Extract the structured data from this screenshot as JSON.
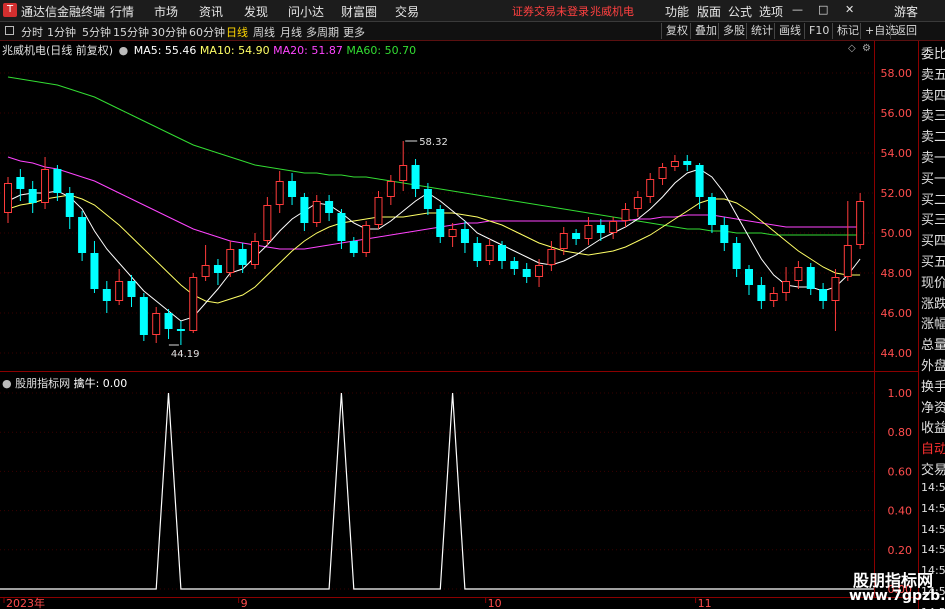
{
  "app": {
    "title": "通达信金融终端"
  },
  "menu": [
    "行情",
    "市场",
    "资讯",
    "发现",
    "问小达",
    "财富圈",
    "交易"
  ],
  "alert": {
    "text1": "证券交易未登录",
    "text2": "兆威机电"
  },
  "menu_right": [
    "功能",
    "版面",
    "公式",
    "选项"
  ],
  "guest": "游客",
  "window_controls": {
    "min": "—",
    "restore": "□",
    "close": "✕"
  },
  "periods": [
    "分时",
    "1分钟",
    "5分钟",
    "15分钟",
    "30分钟",
    "60分钟",
    "日线",
    "周线",
    "月线",
    "多周期",
    "更多"
  ],
  "active_period": "日线",
  "toolbar_right": [
    "复权",
    "叠加",
    "多股",
    "统计",
    "画线",
    "F10",
    "标记",
    "+自选",
    "返回"
  ],
  "main": {
    "stock_name": "兆威机电(日线 前复权)",
    "ma": [
      {
        "label": "MA5: 55.46",
        "color": "#ffffff"
      },
      {
        "label": "MA10: 54.90",
        "color": "#ffff66"
      },
      {
        "label": "MA20: 51.87",
        "color": "#ff44ff"
      },
      {
        "label": "MA60: 50.70",
        "color": "#33dd33"
      }
    ],
    "high_label": "58.32",
    "low_label": "44.19"
  },
  "sub": {
    "indicator_name": "股朋指标网",
    "value_label": "擒牛: 0.00"
  },
  "chart_data": [
    {
      "type": "candlestick",
      "y_ticks": [
        "58.00",
        "56.00",
        "54.00",
        "52.00",
        "50.00",
        "48.00",
        "46.00",
        "44.00"
      ],
      "ylim": [
        43.2,
        59.6
      ],
      "x_labels": [
        {
          "i": 0,
          "label": "2023年"
        },
        {
          "i": 19,
          "label": "9"
        },
        {
          "i": 39,
          "label": "10"
        },
        {
          "i": 56,
          "label": "11"
        }
      ],
      "candles": [
        [
          51.0,
          52.5,
          50.5,
          52.8
        ],
        [
          52.8,
          52.2,
          51.6,
          53.2
        ],
        [
          52.2,
          51.5,
          51.0,
          52.6
        ],
        [
          51.5,
          53.2,
          51.2,
          53.8
        ],
        [
          53.2,
          52.0,
          51.6,
          53.4
        ],
        [
          52.0,
          50.8,
          50.2,
          52.3
        ],
        [
          50.8,
          49.0,
          48.6,
          51.1
        ],
        [
          49.0,
          47.2,
          47.0,
          49.6
        ],
        [
          47.2,
          46.6,
          46.0,
          47.6
        ],
        [
          46.6,
          47.6,
          46.4,
          48.2
        ],
        [
          47.6,
          46.8,
          46.3,
          47.9
        ],
        [
          46.8,
          44.9,
          44.6,
          47.0
        ],
        [
          44.9,
          46.0,
          44.5,
          46.3
        ],
        [
          46.0,
          45.2,
          44.7,
          46.2
        ],
        [
          45.2,
          45.1,
          44.4,
          45.6
        ],
        [
          45.1,
          47.8,
          45.0,
          48.0
        ],
        [
          47.8,
          48.4,
          47.6,
          49.4
        ],
        [
          48.4,
          48.0,
          47.4,
          48.7
        ],
        [
          48.0,
          49.2,
          47.8,
          49.6
        ],
        [
          49.2,
          48.4,
          48.0,
          49.5
        ],
        [
          48.4,
          49.6,
          48.2,
          50.0
        ],
        [
          49.6,
          51.4,
          49.4,
          51.8
        ],
        [
          51.4,
          52.6,
          51.0,
          53.1
        ],
        [
          52.6,
          51.8,
          51.4,
          53.0
        ],
        [
          51.8,
          50.5,
          50.1,
          52.0
        ],
        [
          50.5,
          51.6,
          50.3,
          51.9
        ],
        [
          51.6,
          51.0,
          50.6,
          51.9
        ],
        [
          51.0,
          49.6,
          49.2,
          51.2
        ],
        [
          49.6,
          49.0,
          48.8,
          49.8
        ],
        [
          49.0,
          50.4,
          48.8,
          50.6
        ],
        [
          50.4,
          51.8,
          50.2,
          52.1
        ],
        [
          51.8,
          52.6,
          51.4,
          52.9
        ],
        [
          52.6,
          53.4,
          52.1,
          54.6
        ],
        [
          53.4,
          52.2,
          51.8,
          53.7
        ],
        [
          52.2,
          51.2,
          50.9,
          52.5
        ],
        [
          51.2,
          49.8,
          49.5,
          51.4
        ],
        [
          49.8,
          50.2,
          49.3,
          50.5
        ],
        [
          50.2,
          49.5,
          49.0,
          50.6
        ],
        [
          49.5,
          48.6,
          48.3,
          49.8
        ],
        [
          48.6,
          49.4,
          48.4,
          49.7
        ],
        [
          49.4,
          48.6,
          48.2,
          49.6
        ],
        [
          48.6,
          48.2,
          47.9,
          48.8
        ],
        [
          48.2,
          47.8,
          47.5,
          48.5
        ],
        [
          47.8,
          48.4,
          47.3,
          48.7
        ],
        [
          48.4,
          49.2,
          48.1,
          49.6
        ],
        [
          49.2,
          50.0,
          48.9,
          50.3
        ],
        [
          50.0,
          49.7,
          49.4,
          50.2
        ],
        [
          49.7,
          50.4,
          49.4,
          50.8
        ],
        [
          50.4,
          50.0,
          49.6,
          50.7
        ],
        [
          50.0,
          50.6,
          49.7,
          50.8
        ],
        [
          50.6,
          51.2,
          50.3,
          51.5
        ],
        [
          51.2,
          51.8,
          50.8,
          52.1
        ],
        [
          51.8,
          52.7,
          51.5,
          53.0
        ],
        [
          52.7,
          53.3,
          52.4,
          53.5
        ],
        [
          53.3,
          53.6,
          53.1,
          53.9
        ],
        [
          53.6,
          53.4,
          53.1,
          53.9
        ],
        [
          53.4,
          51.8,
          51.2,
          53.5
        ],
        [
          51.8,
          50.4,
          50.0,
          52.0
        ],
        [
          50.4,
          49.5,
          49.1,
          50.8
        ],
        [
          49.5,
          48.2,
          47.8,
          49.8
        ],
        [
          48.2,
          47.4,
          46.9,
          48.4
        ],
        [
          47.4,
          46.6,
          46.2,
          47.8
        ],
        [
          46.6,
          47.0,
          46.3,
          47.3
        ],
        [
          47.0,
          47.6,
          46.6,
          48.3
        ],
        [
          47.6,
          48.3,
          47.2,
          48.6
        ],
        [
          48.3,
          47.2,
          46.9,
          48.5
        ],
        [
          47.2,
          46.6,
          46.2,
          47.5
        ],
        [
          46.6,
          47.8,
          45.1,
          48.2
        ],
        [
          47.8,
          49.4,
          47.6,
          51.6
        ],
        [
          49.4,
          51.6,
          49.2,
          52.0
        ]
      ],
      "ma5": [
        51.6,
        51.9,
        52.0,
        52.0,
        52.1,
        51.8,
        51.2,
        50.1,
        49.2,
        48.5,
        47.8,
        47.1,
        46.6,
        46.1,
        45.6,
        45.8,
        46.5,
        47.2,
        48.0,
        48.2,
        48.8,
        49.4,
        50.1,
        50.7,
        51.1,
        51.5,
        51.4,
        51.0,
        50.5,
        50.2,
        50.2,
        50.6,
        51.1,
        51.6,
        52.0,
        51.6,
        51.1,
        50.6,
        50.0,
        49.7,
        49.4,
        49.1,
        48.8,
        48.5,
        48.4,
        48.6,
        48.9,
        49.3,
        49.7,
        50.0,
        50.3,
        50.7,
        51.2,
        51.8,
        52.5,
        53.0,
        53.2,
        52.8,
        52.0,
        50.9,
        49.8,
        48.7,
        47.9,
        47.4,
        47.3,
        47.3,
        47.1,
        47.3,
        47.9,
        48.7
      ],
      "ma10": [
        51.2,
        51.4,
        51.5,
        51.7,
        51.8,
        51.9,
        51.7,
        51.4,
        50.9,
        50.4,
        49.8,
        49.2,
        48.6,
        48.0,
        47.4,
        46.9,
        46.6,
        46.5,
        46.7,
        46.9,
        47.3,
        47.9,
        48.5,
        49.1,
        49.6,
        50.0,
        50.3,
        50.5,
        50.6,
        50.7,
        50.8,
        50.8,
        50.8,
        50.9,
        51.0,
        51.0,
        51.0,
        50.9,
        50.8,
        50.6,
        50.4,
        50.1,
        49.8,
        49.5,
        49.3,
        49.1,
        49.0,
        48.9,
        49.0,
        49.1,
        49.3,
        49.6,
        49.9,
        50.3,
        50.7,
        51.1,
        51.5,
        51.7,
        51.7,
        51.5,
        51.1,
        50.6,
        50.1,
        49.6,
        49.1,
        48.7,
        48.3,
        48.0,
        47.9,
        47.9
      ],
      "ma20": [
        53.8,
        53.6,
        53.5,
        53.3,
        53.2,
        53.0,
        52.8,
        52.6,
        52.3,
        52.0,
        51.7,
        51.4,
        51.1,
        50.8,
        50.5,
        50.2,
        50.0,
        49.8,
        49.6,
        49.5,
        49.4,
        49.3,
        49.2,
        49.2,
        49.2,
        49.3,
        49.4,
        49.5,
        49.6,
        49.7,
        49.8,
        49.9,
        50.0,
        50.1,
        50.2,
        50.3,
        50.4,
        50.5,
        50.5,
        50.6,
        50.6,
        50.6,
        50.6,
        50.6,
        50.6,
        50.6,
        50.6,
        50.6,
        50.6,
        50.6,
        50.6,
        50.7,
        50.7,
        50.8,
        50.8,
        50.9,
        50.9,
        50.9,
        50.8,
        50.7,
        50.6,
        50.5,
        50.4,
        50.3,
        50.3,
        50.3,
        50.3,
        50.3,
        50.3,
        50.3
      ],
      "ma60": [
        57.8,
        57.7,
        57.6,
        57.5,
        57.4,
        57.2,
        57.0,
        56.8,
        56.5,
        56.2,
        55.9,
        55.6,
        55.3,
        55.0,
        54.7,
        54.4,
        54.2,
        54.0,
        53.8,
        53.6,
        53.4,
        53.3,
        53.2,
        53.1,
        53.0,
        53.0,
        52.9,
        52.9,
        52.8,
        52.8,
        52.7,
        52.6,
        52.5,
        52.4,
        52.3,
        52.2,
        52.1,
        52.0,
        51.9,
        51.8,
        51.7,
        51.6,
        51.5,
        51.4,
        51.3,
        51.2,
        51.1,
        51.0,
        50.9,
        50.8,
        50.7,
        50.6,
        50.5,
        50.4,
        50.3,
        50.2,
        50.2,
        50.1,
        50.1,
        50.0,
        50.0,
        50.0,
        49.9,
        49.9,
        49.9,
        49.9,
        49.9,
        49.9,
        49.9,
        49.9
      ]
    },
    {
      "type": "line",
      "y_ticks": [
        "1.00",
        "0.80",
        "0.60",
        "0.40",
        "0.20",
        "0.00"
      ],
      "ylim": [
        0,
        1
      ],
      "spikes": [
        13,
        27,
        36
      ]
    }
  ]
}
